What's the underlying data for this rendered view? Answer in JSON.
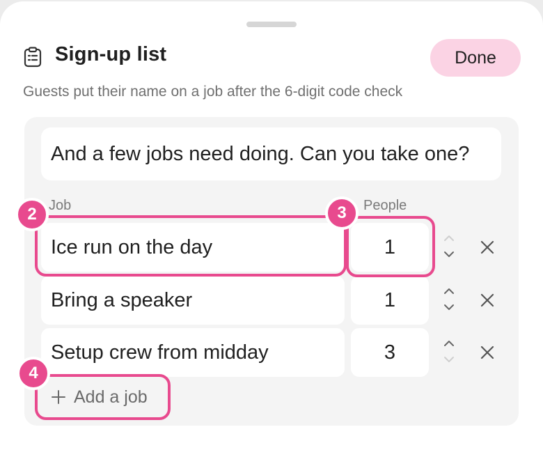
{
  "sheet": {
    "title": "Sign-up list",
    "done_label": "Done",
    "subtitle": "Guests put their name on a job after the 6-digit code check",
    "message_value": "And a few jobs need doing. Can you take one?"
  },
  "columns": {
    "job": "Job",
    "people": "People"
  },
  "jobs": [
    {
      "name": "Ice run on the day",
      "people": "1"
    },
    {
      "name": "Bring a speaker",
      "people": "1"
    },
    {
      "name": "Setup crew from midday",
      "people": "3"
    }
  ],
  "add_job_label": "Add a job",
  "badges": {
    "job_field": "2",
    "people_field": "3",
    "add_job": "4"
  },
  "icons": {
    "header": "clipboard-icon",
    "stepper": "chevron-up-down-icon",
    "remove": "close-icon",
    "add": "plus-icon"
  },
  "colors": {
    "accent": "#e84a8e",
    "done_bg": "#fbd3e4",
    "panel_bg": "#f4f4f4"
  }
}
